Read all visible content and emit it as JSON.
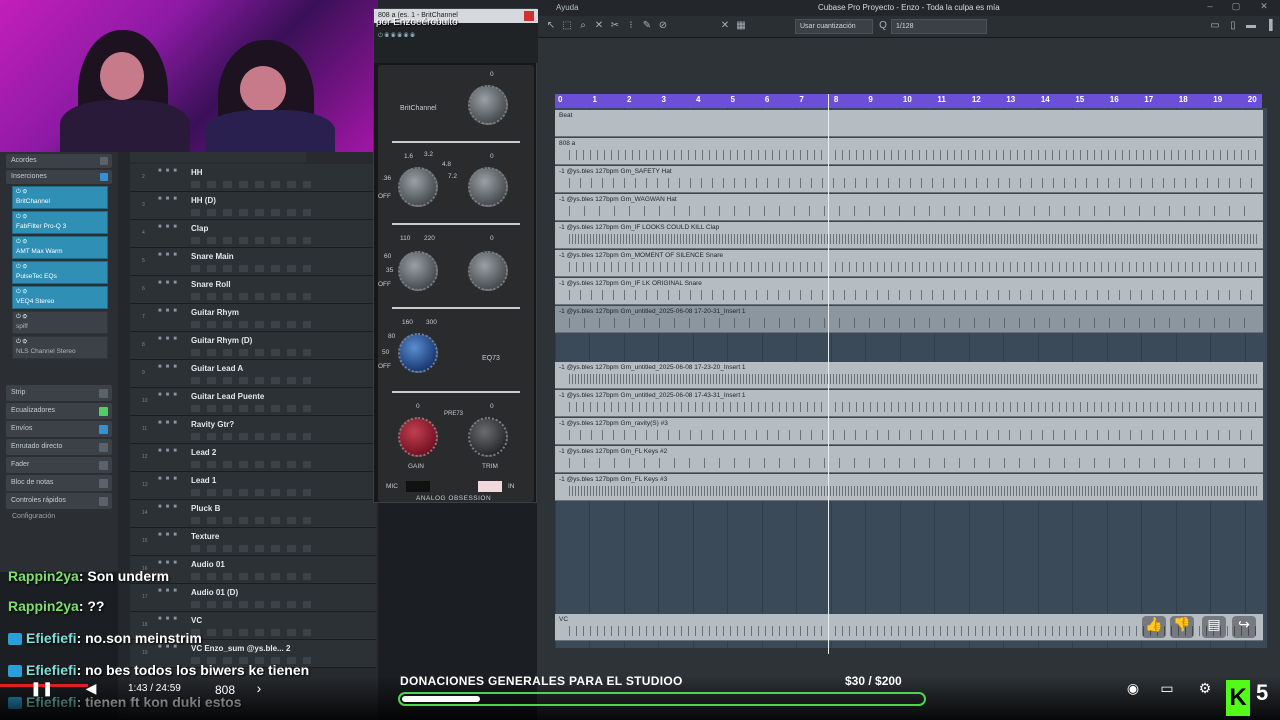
{
  "app": {
    "menu_last": "Ayuda",
    "window_title": "Cubase Pro Proyecto - Enzo - Toda la culpa es mía",
    "quantize_label": "Usar cuantización",
    "quantize_value": "1/128"
  },
  "plugin": {
    "title": "808 a (es. 1 - BritChannel",
    "overlay_user": "por Enzoeérobulto",
    "brand": "BritChannel",
    "eq_label": "EQ73",
    "pre_label": "PRE73",
    "gain_label": "GAIN",
    "trim_label": "TRIM",
    "mic_label": "MIC",
    "in_label": "IN",
    "footer": "ANALOG OBSESSION",
    "freq_labels": [
      "1.6",
      "3.2",
      "4.8",
      "7.2",
      "OFF",
      ".36",
      "110",
      "220",
      "60",
      "35",
      "OFF",
      "160",
      "300",
      "80",
      "50",
      "OFF"
    ],
    "zero_labels": [
      "0",
      "0",
      "0",
      "0",
      "0"
    ]
  },
  "inspector": {
    "head1": "Acordes",
    "head2": "Inserciones",
    "inserts": [
      "BritChannel",
      "FabFilter Pro-Q 3",
      "AMT Max Warm",
      "PulseTec EQs",
      "VEQ4 Stereo",
      "spiff",
      "NLS Channel Stereo"
    ],
    "sections": [
      "Strip",
      "Ecualizadores",
      "Envíos",
      "Enrutado directo",
      "Fader",
      "Bloc de notas",
      "Controles rápidos"
    ],
    "config": "Configuración"
  },
  "tracks": [
    "HH",
    "HH (D)",
    "Clap",
    "Snare Main",
    "Snare Roll",
    "Guitar Rhym",
    "Guitar Rhym (D)",
    "Guitar Lead A",
    "Guitar Lead Puente",
    "Ravity Gtr?",
    "Lead 2",
    "Lead 1",
    "Pluck B",
    "Texture",
    "Audio 01",
    "Audio 01 (D)",
    "VC",
    "VC Enzo_sum @ys.ble... 2"
  ],
  "ruler": [
    "0",
    "1",
    "2",
    "3",
    "4",
    "5",
    "6",
    "7",
    "8",
    "9",
    "10",
    "11",
    "12",
    "13",
    "14",
    "15",
    "16",
    "17",
    "18",
    "19",
    "20"
  ],
  "lanes": [
    "Beat",
    "808 a",
    "-1 @ys.bles 127bpm Gm_SAFETY Hat",
    "-1 @ys.bles 127bpm Gm_WAGWAN Hat",
    "-1 @ys.bles 127bpm Gm_IF LOOKS COULD KILL Clap",
    "-1 @ys.bles 127bpm Gm_MOMENT OF SILENCE Snare",
    "-1 @ys.bles 127bpm Gm_IF LK ORIGINAL Snare",
    "-1 @ys.bles 127bpm Gm_untitled_2025-06-08 17-20-31_Insert 1",
    "-1 @ys.bles 127bpm Gm_untitled_2025-06-08 17-23-20_Insert 1",
    "-1 @ys.bles 127bpm Gm_untitled_2025-06-08 17-43-31_Insert 1",
    "-1 @ys.bles 127bpm Gm_ravity(S) #3",
    "-1 @ys.bles 127bpm Gm_FL Keys #2",
    "-1 @ys.bles 127bpm Gm_FL Keys #3",
    "VC"
  ],
  "chat": [
    {
      "user": "Rappin2ya",
      "text": ": Son underm"
    },
    {
      "user": "Rappin2ya",
      "text": ": ??"
    },
    {
      "user": "Efiefiefi",
      "text": ": no.son meinstrim"
    },
    {
      "user": "Efiefiefi",
      "text": ": no bes todos los biwers ke tienen"
    },
    {
      "user": "Efiefiefi",
      "text": ": tienen ft kon duki estos"
    }
  ],
  "video": {
    "time": "1:43 / 24:59",
    "chapter": "808",
    "progress": 0.069,
    "donation_label": "DONACIONES GENERALES PARA EL STUDIOO",
    "donation_amount": "$30   / $200",
    "donation_fraction": 0.15,
    "kick_letter": "K",
    "kick_count": "5"
  },
  "colors": {
    "ruler": "#6b4fd6",
    "insert_slot": "#2f8fb5",
    "chat_user": "#7de06a",
    "donation_bar": "#4ad84a",
    "progress": "#e02020"
  }
}
